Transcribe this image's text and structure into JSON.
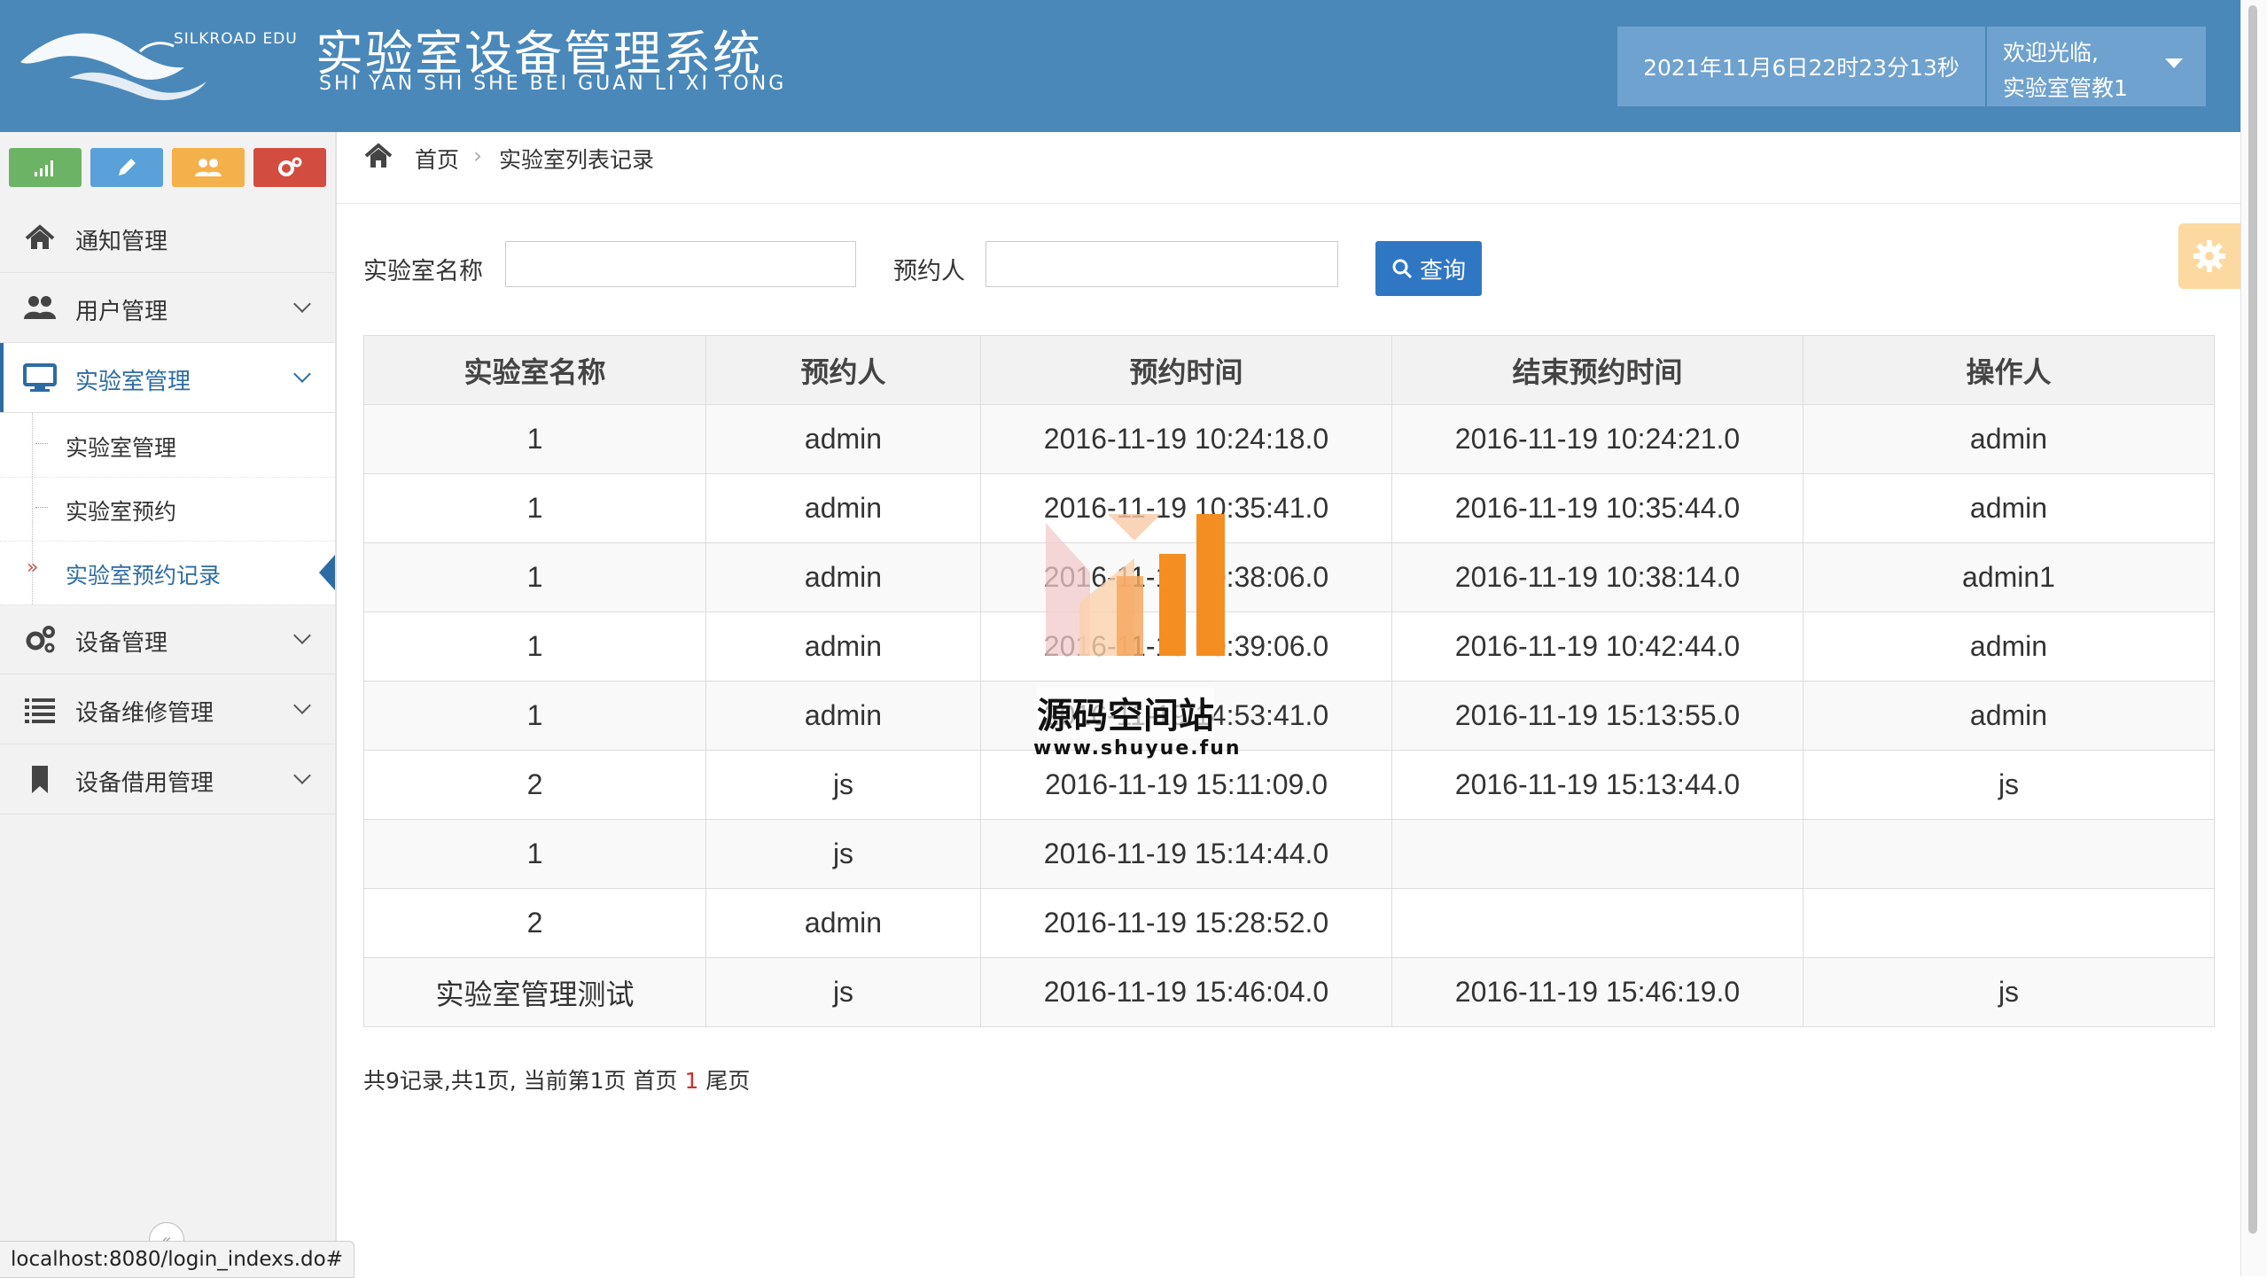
{
  "header": {
    "logo_en": "SILKROAD EDU",
    "title_cn": "实验室设备管理系统",
    "title_pinyin": "SHI YAN SHI SHE BEI GUAN LI XI TONG",
    "datetime": "2021年11月6日22时23分13秒",
    "welcome": "欢迎光临,",
    "username": "实验室管教1",
    "colors": {
      "header_bg": "#4a88ba",
      "header_box": "#6fa2ce"
    }
  },
  "sidebar": {
    "shortcuts": [
      {
        "icon": "bar-chart-icon",
        "color": "#6db365"
      },
      {
        "icon": "pencil-icon",
        "color": "#5aa0d9"
      },
      {
        "icon": "users-icon",
        "color": "#f4b04a"
      },
      {
        "icon": "gears-icon",
        "color": "#d24d3f"
      }
    ],
    "items": [
      {
        "label": "通知管理",
        "icon": "home-icon"
      },
      {
        "label": "用户管理",
        "icon": "users-icon"
      },
      {
        "label": "实验室管理",
        "icon": "monitor-icon"
      },
      {
        "label": "设备管理",
        "icon": "gears-icon"
      },
      {
        "label": "设备维修管理",
        "icon": "list-icon"
      },
      {
        "label": "设备借用管理",
        "icon": "bookmark-icon"
      }
    ],
    "submenu": [
      {
        "label": "实验室管理"
      },
      {
        "label": "实验室预约"
      },
      {
        "label": "实验室预约记录"
      }
    ],
    "current_marker": "»",
    "collapse_glyph": "«"
  },
  "breadcrumb": {
    "home": "首页",
    "separator": "›",
    "current": "实验室列表记录"
  },
  "search": {
    "lab_name_label": "实验室名称",
    "lab_name_value": "",
    "booker_label": "预约人",
    "booker_value": "",
    "query_button": "查询"
  },
  "table": {
    "headers": [
      "实验室名称",
      "预约人",
      "预约时间",
      "结束预约时间",
      "操作人"
    ],
    "rows": [
      [
        "1",
        "admin",
        "2016-11-19 10:24:18.0",
        "2016-11-19 10:24:21.0",
        "admin"
      ],
      [
        "1",
        "admin",
        "2016-11-19 10:35:41.0",
        "2016-11-19 10:35:44.0",
        "admin"
      ],
      [
        "1",
        "admin",
        "2016-11-19 10:38:06.0",
        "2016-11-19 10:38:14.0",
        "admin1"
      ],
      [
        "1",
        "admin",
        "2016-11-19 10:39:06.0",
        "2016-11-19 10:42:44.0",
        "admin"
      ],
      [
        "1",
        "admin",
        "2016-11-19 14:53:41.0",
        "2016-11-19 15:13:55.0",
        "admin"
      ],
      [
        "2",
        "js",
        "2016-11-19 15:11:09.0",
        "2016-11-19 15:13:44.0",
        "js"
      ],
      [
        "1",
        "js",
        "2016-11-19 15:14:44.0",
        "",
        ""
      ],
      [
        "2",
        "admin",
        "2016-11-19 15:28:52.0",
        "",
        ""
      ],
      [
        "实验室管理测试",
        "js",
        "2016-11-19 15:46:04.0",
        "2016-11-19 15:46:19.0",
        "js"
      ]
    ]
  },
  "pagination": {
    "summary": "共9记录,共1页, 当前第1页",
    "first": "首页",
    "current_page": "1",
    "last": "尾页"
  },
  "watermark": {
    "name": "源码空间站",
    "url": "www.shuyue.fun"
  },
  "statusbar": {
    "url": "localhost:8080/login_indexs.do#"
  }
}
